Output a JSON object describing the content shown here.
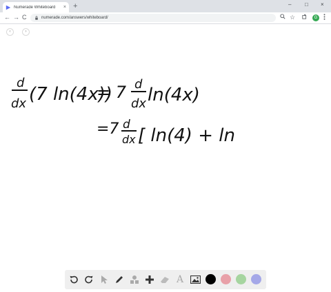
{
  "browser": {
    "tab_title": "Numerade Whiteboard",
    "tab_close": "×",
    "new_tab": "+",
    "url": "numerade.com/answers/whiteboard/",
    "avatar_letter": "G",
    "window_controls": {
      "minimize": "–",
      "maximize": "□",
      "close": "×"
    }
  },
  "nav": {
    "back": "←",
    "forward": "→",
    "reload": "C",
    "star": "☆"
  },
  "whiteboard": {
    "page_prev": "‹",
    "page_next": "›",
    "handwriting": {
      "line1_lhs_num": "d",
      "line1_lhs_den": "dx",
      "line1_lhs_body": "(7 ln(4x))",
      "line1_eq": "= 7",
      "line1_rhs_num": "d",
      "line1_rhs_den": "dx",
      "line1_rhs_body": "ln(4x)",
      "line2_eq": "=7",
      "line2_num": "d",
      "line2_den": "dx",
      "line2_body": "[ ln(4) + ln"
    }
  },
  "toolbar": {
    "tools": [
      "undo-icon",
      "redo-icon",
      "pointer-icon",
      "pen-icon",
      "shapes-icon",
      "add-icon",
      "eraser-icon",
      "text-icon",
      "image-icon"
    ],
    "text_tool_label": "A",
    "colors": [
      "#000000",
      "#e8a0a8",
      "#a6d5a0",
      "#a5a8e8"
    ]
  }
}
